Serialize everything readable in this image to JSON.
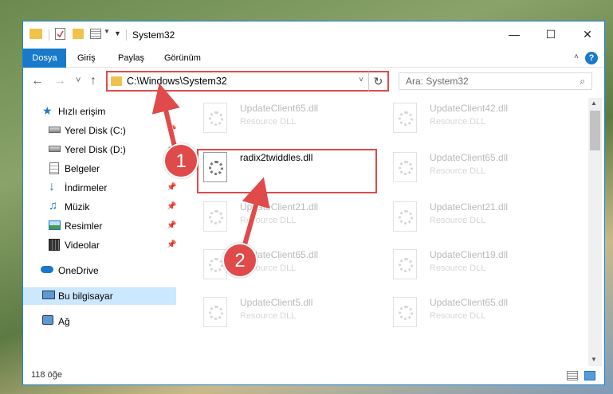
{
  "window": {
    "title": "System32",
    "minimize_glyph": "—",
    "maximize_glyph": "☐",
    "close_glyph": "✕"
  },
  "ribbon": {
    "tabs": [
      "Dosya",
      "Giriş",
      "Paylaş",
      "Görünüm"
    ],
    "help_glyph": "?",
    "collapse_glyph": "˄"
  },
  "navigation": {
    "back_glyph": "←",
    "forward_glyph": "→",
    "recent_glyph": "˅",
    "up_glyph": "↑",
    "address": "C:\\Windows\\System32",
    "address_dropdown_glyph": "˅",
    "refresh_glyph": "↻",
    "search_placeholder": "Ara: System32",
    "search_glyph": "⌕"
  },
  "sidebar": {
    "items": [
      {
        "label": "Hızlı erişim",
        "icon": "star-icon",
        "pinned": false
      },
      {
        "label": "Yerel Disk (C:)",
        "icon": "drive-icon",
        "pinned": true
      },
      {
        "label": "Yerel Disk (D:)",
        "icon": "drive-icon",
        "pinned": true
      },
      {
        "label": "Belgeler",
        "icon": "documents-icon",
        "pinned": true
      },
      {
        "label": "İndirmeler",
        "icon": "download-icon",
        "pinned": true
      },
      {
        "label": "Müzik",
        "icon": "music-icon",
        "pinned": true
      },
      {
        "label": "Resimler",
        "icon": "pictures-icon",
        "pinned": true
      },
      {
        "label": "Videolar",
        "icon": "video-icon",
        "pinned": true
      },
      {
        "label": "OneDrive",
        "icon": "cloud-icon",
        "pinned": false
      },
      {
        "label": "Bu bilgisayar",
        "icon": "computer-icon",
        "pinned": false,
        "selected": true
      },
      {
        "label": "Ağ",
        "icon": "network-icon",
        "pinned": false
      }
    ],
    "pin_glyph": "📌"
  },
  "files": {
    "left_column": [
      {
        "name": "UpdateClient65.dll",
        "type": "Resource DLL"
      },
      {
        "name": "radix2twiddles.dll",
        "type": ""
      },
      {
        "name": "UpdateClient21.dll",
        "type": "Resource DLL"
      },
      {
        "name": "UpdateClient65.dll",
        "type": "Resource DLL"
      },
      {
        "name": "UpdateClient5.dll",
        "type": "Resource DLL"
      }
    ],
    "right_column": [
      {
        "name": "UpdateClient42.dll",
        "type": "Resource DLL"
      },
      {
        "name": "UpdateClient65.dll",
        "type": "Resource DLL"
      },
      {
        "name": "UpdateClient21.dll",
        "type": "Resource DLL"
      },
      {
        "name": "UpdateClient19.dll",
        "type": "Resource DLL"
      },
      {
        "name": "UpdateClient65.dll",
        "type": "Resource DLL"
      }
    ]
  },
  "status": {
    "item_count": "118 öğe"
  },
  "callouts": {
    "step1": "1",
    "step2": "2"
  },
  "colors": {
    "accent": "#1979ca",
    "callout": "#e04a4a",
    "selection": "#cce8ff"
  }
}
